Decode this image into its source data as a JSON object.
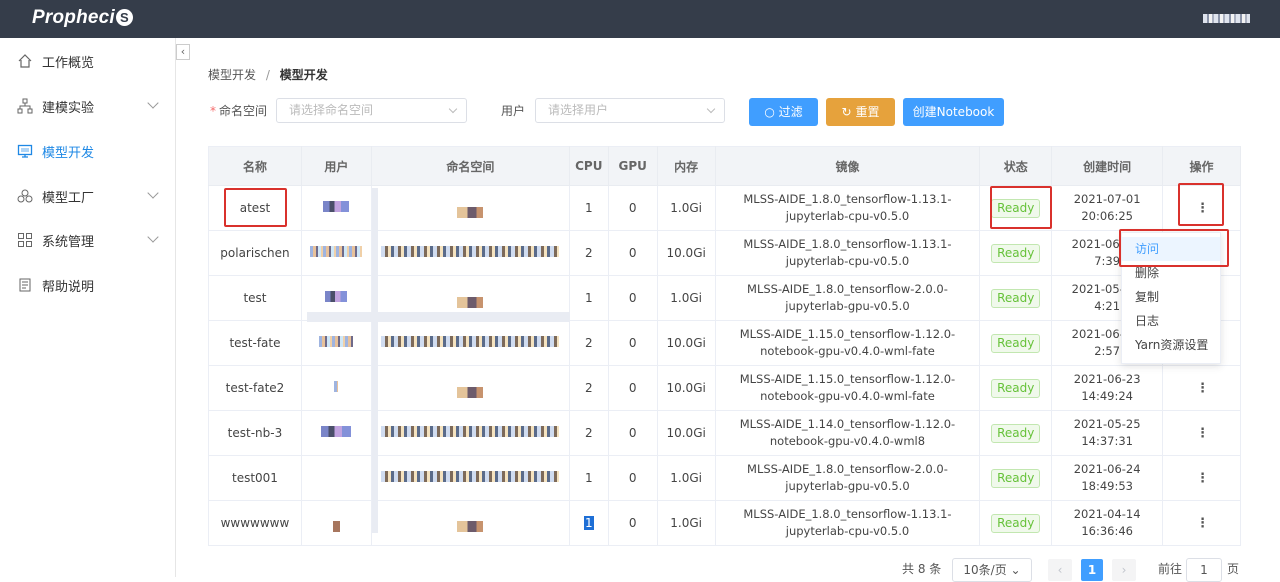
{
  "app": {
    "logo_text": "Propheci",
    "logo_s": "S"
  },
  "sidebar": {
    "items": [
      {
        "label": "工作概览",
        "icon": "home-icon"
      },
      {
        "label": "建模实验",
        "icon": "hierarchy-icon"
      },
      {
        "label": "模型开发",
        "icon": "monitor-icon",
        "active": true
      },
      {
        "label": "模型工厂",
        "icon": "factory-icon"
      },
      {
        "label": "系统管理",
        "icon": "grid-icon"
      },
      {
        "label": "帮助说明",
        "icon": "document-icon"
      }
    ]
  },
  "breadcrumb": {
    "parent": "模型开发",
    "separator": "/",
    "current": "模型开发"
  },
  "filters": {
    "namespace_label": "命名空间",
    "namespace_required": "*",
    "namespace_placeholder": "请选择命名空间",
    "user_label": "用户",
    "user_placeholder": "请选择用户"
  },
  "buttons": {
    "filter": "过滤",
    "reset": "重置",
    "create": "创建Notebook"
  },
  "table": {
    "headers": [
      "名称",
      "用户",
      "命名空间",
      "CPU",
      "GPU",
      "内存",
      "镜像",
      "状态",
      "创建时间",
      "操作"
    ],
    "rows": [
      {
        "name": "atest",
        "cpu": "1",
        "gpu": "0",
        "mem": "1.0Gi",
        "image": "MLSS-AIDE_1.8.0_tensorflow-1.13.1-jupyterlab-cpu-v0.5.0",
        "status": "Ready",
        "created": "2021-07-01 20:06:25"
      },
      {
        "name": "polarischen",
        "cpu": "2",
        "gpu": "0",
        "mem": "10.0Gi",
        "image": "MLSS-AIDE_1.8.0_tensorflow-1.13.1-jupyterlab-cpu-v0.5.0",
        "status": "Ready",
        "created": "2021-06-0… 7:39"
      },
      {
        "name": "test",
        "cpu": "1",
        "gpu": "0",
        "mem": "1.0Gi",
        "image": "MLSS-AIDE_1.8.0_tensorflow-2.0.0-jupyterlab-gpu-v0.5.0",
        "status": "Ready",
        "created": "2021-05-2… 4:21"
      },
      {
        "name": "test-fate",
        "cpu": "2",
        "gpu": "0",
        "mem": "10.0Gi",
        "image": "MLSS-AIDE_1.15.0_tensorflow-1.12.0-notebook-gpu-v0.4.0-wml-fate",
        "status": "Ready",
        "created": "2021-06-1… 2:57"
      },
      {
        "name": "test-fate2",
        "cpu": "2",
        "gpu": "0",
        "mem": "10.0Gi",
        "image": "MLSS-AIDE_1.15.0_tensorflow-1.12.0-notebook-gpu-v0.4.0-wml-fate",
        "status": "Ready",
        "created": "2021-06-23 14:49:24"
      },
      {
        "name": "test-nb-3",
        "cpu": "2",
        "gpu": "0",
        "mem": "10.0Gi",
        "image": "MLSS-AIDE_1.14.0_tensorflow-1.12.0-notebook-gpu-v0.4.0-wml8",
        "status": "Ready",
        "created": "2021-05-25 14:37:31"
      },
      {
        "name": "test001",
        "cpu": "1",
        "gpu": "0",
        "mem": "1.0Gi",
        "image": "MLSS-AIDE_1.8.0_tensorflow-2.0.0-jupyterlab-gpu-v0.5.0",
        "status": "Ready",
        "created": "2021-06-24 18:49:53"
      },
      {
        "name": "wwwwwww",
        "cpu": "1",
        "gpu": "0",
        "mem": "1.0Gi",
        "image": "MLSS-AIDE_1.8.0_tensorflow-1.13.1-jupyterlab-cpu-v0.5.0",
        "status": "Ready",
        "created": "2021-04-14 16:36:46"
      }
    ]
  },
  "dropdown": {
    "items": [
      "访问",
      "删除",
      "复制",
      "日志",
      "Yarn资源设置"
    ]
  },
  "pagination": {
    "total": "共 8 条",
    "page_size": "10条/页",
    "current_page": "1",
    "goto_label": "前往",
    "goto_value": "1",
    "page_suffix": "页"
  }
}
